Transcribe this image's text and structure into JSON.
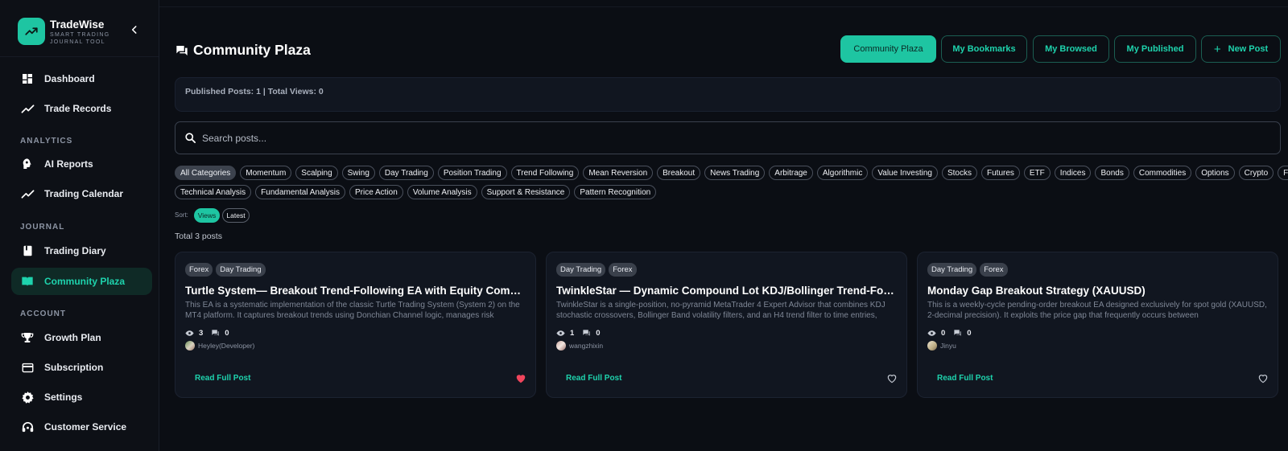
{
  "brand": {
    "name": "TradeWise",
    "subtitle": "SMART TRADING JOURNAL TOOL",
    "accent": "#1ec5a2"
  },
  "sidebar": {
    "items": [
      {
        "label": "Dashboard",
        "icon": "dashboard-icon"
      },
      {
        "label": "Trade Records",
        "icon": "trend-icon"
      },
      {
        "label": "AI Reports",
        "icon": "ai-head-icon"
      },
      {
        "label": "Trading Calendar",
        "icon": "trend-icon"
      },
      {
        "label": "Trading Diary",
        "icon": "book-icon"
      },
      {
        "label": "Community Plaza",
        "icon": "open-book-icon",
        "active": true
      },
      {
        "label": "Growth Plan",
        "icon": "trophy-icon"
      },
      {
        "label": "Subscription",
        "icon": "credit-card-icon"
      },
      {
        "label": "Settings",
        "icon": "gear-icon"
      },
      {
        "label": "Customer Service",
        "icon": "headset-icon"
      }
    ],
    "sections": {
      "analytics": "ANALYTICS",
      "journal": "JOURNAL",
      "account": "ACCOUNT"
    }
  },
  "header": {
    "title": "Community Plaza",
    "tabs": [
      {
        "label": "Community Plaza",
        "active": true
      },
      {
        "label": "My Bookmarks"
      },
      {
        "label": "My Browsed"
      },
      {
        "label": "My Published"
      },
      {
        "label": "New Post",
        "icon": "plus-icon"
      }
    ]
  },
  "stats": {
    "text": "Published Posts: 1 | Total Views: 0"
  },
  "search": {
    "placeholder": "Search posts..."
  },
  "categories": {
    "row1": [
      "All Categories",
      "Momentum",
      "Scalping",
      "Swing",
      "Day Trading",
      "Position Trading",
      "Trend Following",
      "Mean Reversion",
      "Breakout",
      "News Trading",
      "Arbitrage",
      "Algorithmic",
      "Value Investing",
      "Stocks",
      "Futures",
      "ETF",
      "Indices",
      "Bonds",
      "Commodities",
      "Options",
      "Crypto",
      "Forex"
    ],
    "row2": [
      "Technical Analysis",
      "Fundamental Analysis",
      "Price Action",
      "Volume Analysis",
      "Support & Resistance",
      "Pattern Recognition"
    ],
    "active": "All Categories"
  },
  "sort": {
    "label": "Sort:",
    "options": [
      "Views",
      "Latest"
    ],
    "active": "Views"
  },
  "total": "Total 3 posts",
  "posts": [
    {
      "tags": [
        "Forex",
        "Day Trading"
      ],
      "title": "Turtle System— Breakout Trend-Following EA with Equity Compounding",
      "excerpt": "This EA is a systematic implementation of the classic Turtle Trading System (System 2) on the MT4 platform. It captures breakout trends using Donchian Channel logic, manages risk",
      "views": "3",
      "comments": "0",
      "author": "Heyley(Developer)",
      "read_more": "Read Full Post",
      "liked": true
    },
    {
      "tags": [
        "Day Trading",
        "Forex"
      ],
      "title": "TwinkleStar — Dynamic Compound Lot KDJ/Bollinger Trend-Following EA",
      "excerpt": "TwinkleStar is a single-position, no-pyramid MetaTrader 4 Expert Advisor that combines KDJ stochastic crossovers, Bollinger Band volatility filters, and an H4 trend filter to time entries,",
      "views": "1",
      "comments": "0",
      "author": "wangzhixin",
      "read_more": "Read Full Post",
      "liked": false
    },
    {
      "tags": [
        "Day Trading",
        "Forex"
      ],
      "title": "Monday Gap Breakout Strategy (XAUUSD)",
      "excerpt": "This is a weekly-cycle pending-order breakout EA designed exclusively for spot gold (XAUUSD, 2-decimal precision). It exploits the price gap that frequently occurs between",
      "views": "0",
      "comments": "0",
      "author": "Jinyu",
      "read_more": "Read Full Post",
      "liked": false
    }
  ]
}
